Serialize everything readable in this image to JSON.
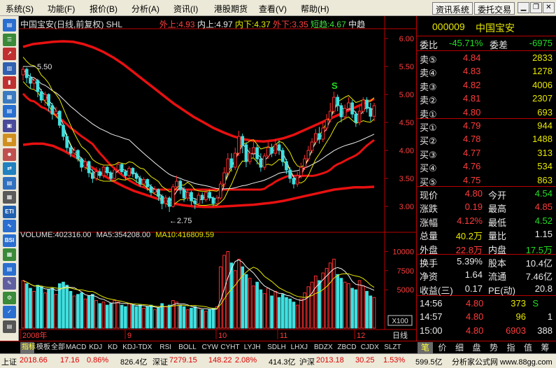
{
  "menu": {
    "items": [
      "系统(S)",
      "功能(F)",
      "报价(B)",
      "分析(A)",
      "资讯(I)",
      "港股期货",
      "查看(V)",
      "帮助(H)"
    ],
    "right_buttons": [
      "资讯系统",
      "委托交易"
    ]
  },
  "toolbar": {
    "icons": [
      "window-icon",
      "list-icon",
      "line-chart-icon",
      "volume-chart-icon",
      "bar-chart-icon",
      "grid-icon",
      "table-icon",
      "page-icon",
      "folder-icon",
      "people-icon",
      "exchange-icon",
      "report-icon",
      "calc-icon",
      "eti-icon",
      "chart-line-icon",
      "bsi-icon",
      "group-icon",
      "doc-icon",
      "wand-icon",
      "gear-icon",
      "tag-icon",
      "scroll-icon"
    ]
  },
  "chart": {
    "legend": {
      "name": "中国宝安(日线,前复权) SHL",
      "wai_shang": "外上:4.93",
      "nei_shang": "内上:4.97",
      "nei_xia": "内下:4.37",
      "wai_xia": "外下:3.35",
      "duan_qu": "短趋:4.67",
      "zhong_qu": "中趋"
    },
    "annotations": {
      "high": "5.50",
      "low": "←2.75",
      "signal": "S"
    },
    "x_labels": [
      "2008年",
      "9",
      "10",
      "11",
      "12"
    ],
    "period_label": "日线",
    "vol_scale": "X100",
    "volume_info": {
      "volume": "VOLUME:402316.00",
      "ma5": "MA5:354208.00",
      "ma10": "MA10:416809.59"
    }
  },
  "chart_data": {
    "type": "candlestick",
    "y_ticks": [
      "6.00",
      "5.50",
      "5.00",
      "4.50",
      "4.00",
      "3.50",
      "3.00"
    ],
    "ylim": [
      2.6,
      6.1
    ],
    "vol_ticks": [
      "10000",
      "7500",
      "5000"
    ],
    "vol_ylim": [
      0,
      11500
    ],
    "candles": [
      [
        5.35,
        5.45,
        5.5,
        5.25,
        6200
      ],
      [
        5.45,
        5.3,
        5.48,
        5.2,
        5800
      ],
      [
        5.3,
        5.2,
        5.38,
        5.1,
        5200
      ],
      [
        5.2,
        5.25,
        5.3,
        5.08,
        4800
      ],
      [
        5.25,
        5.05,
        5.28,
        4.95,
        5600
      ],
      [
        5.05,
        4.9,
        5.1,
        4.85,
        5400
      ],
      [
        4.9,
        5.0,
        5.05,
        4.8,
        4600
      ],
      [
        5.0,
        4.8,
        5.02,
        4.7,
        5000
      ],
      [
        4.8,
        4.65,
        4.85,
        4.55,
        5200
      ],
      [
        4.65,
        4.7,
        4.78,
        4.58,
        4400
      ],
      [
        4.7,
        4.45,
        4.72,
        4.4,
        5800
      ],
      [
        4.45,
        4.25,
        4.48,
        4.18,
        6000
      ],
      [
        4.25,
        4.05,
        4.3,
        3.98,
        5600
      ],
      [
        4.05,
        3.95,
        4.1,
        3.88,
        4800
      ],
      [
        3.95,
        4.0,
        4.06,
        3.9,
        4200
      ],
      [
        4.0,
        3.85,
        4.02,
        3.8,
        4400
      ],
      [
        3.85,
        3.7,
        3.88,
        3.62,
        4600
      ],
      [
        3.7,
        3.8,
        3.86,
        3.65,
        3800
      ],
      [
        3.8,
        3.6,
        3.82,
        3.52,
        4200
      ],
      [
        3.6,
        3.5,
        3.66,
        3.42,
        4400
      ],
      [
        3.5,
        3.62,
        3.7,
        3.46,
        3600
      ],
      [
        3.62,
        3.55,
        3.68,
        3.5,
        3200
      ],
      [
        3.55,
        3.7,
        3.75,
        3.5,
        3400
      ],
      [
        3.7,
        3.6,
        3.72,
        3.55,
        3000
      ],
      [
        3.6,
        3.5,
        3.64,
        3.45,
        3200
      ],
      [
        3.5,
        3.65,
        3.7,
        3.48,
        3600
      ],
      [
        3.65,
        3.75,
        3.8,
        3.6,
        3400
      ],
      [
        3.75,
        3.62,
        3.78,
        3.58,
        3000
      ],
      [
        3.62,
        3.55,
        3.66,
        3.48,
        2800
      ],
      [
        3.55,
        3.68,
        3.72,
        3.52,
        3200
      ],
      [
        3.68,
        3.58,
        3.7,
        3.52,
        3000
      ],
      [
        3.58,
        3.5,
        3.62,
        3.42,
        2800
      ],
      [
        3.5,
        3.4,
        3.55,
        3.35,
        3000
      ],
      [
        3.4,
        3.48,
        3.52,
        3.35,
        2600
      ],
      [
        3.48,
        3.35,
        3.5,
        3.28,
        2800
      ],
      [
        3.35,
        3.25,
        3.4,
        3.18,
        3000
      ],
      [
        3.25,
        3.3,
        3.36,
        3.2,
        2400
      ],
      [
        3.3,
        3.18,
        3.32,
        3.1,
        2600
      ],
      [
        3.18,
        3.05,
        3.22,
        2.95,
        3200
      ],
      [
        3.05,
        3.15,
        3.2,
        2.98,
        2800
      ],
      [
        3.15,
        3.0,
        3.18,
        2.9,
        3000
      ],
      [
        3.0,
        3.35,
        3.4,
        2.98,
        3600
      ],
      [
        3.35,
        3.45,
        3.55,
        3.3,
        3400
      ],
      [
        3.45,
        3.3,
        3.48,
        3.22,
        3000
      ],
      [
        3.3,
        3.15,
        3.35,
        3.08,
        2800
      ],
      [
        3.15,
        3.25,
        3.3,
        3.1,
        2400
      ],
      [
        3.25,
        3.1,
        3.28,
        3.02,
        2600
      ],
      [
        3.1,
        3.05,
        3.15,
        2.95,
        2800
      ],
      [
        3.05,
        3.2,
        3.25,
        3.0,
        2600
      ],
      [
        3.2,
        3.12,
        3.25,
        3.05,
        2400
      ],
      [
        3.12,
        3.25,
        3.3,
        3.08,
        2200
      ],
      [
        3.25,
        3.15,
        3.3,
        3.1,
        2400
      ],
      [
        3.15,
        3.05,
        3.18,
        3.0,
        2600
      ],
      [
        3.05,
        3.15,
        3.2,
        3.02,
        2800
      ],
      [
        3.15,
        3.4,
        3.45,
        3.12,
        8000
      ],
      [
        3.4,
        3.6,
        3.7,
        3.35,
        9500
      ],
      [
        3.6,
        3.85,
        3.95,
        3.55,
        10000
      ],
      [
        3.85,
        3.7,
        3.95,
        3.62,
        8500
      ],
      [
        3.7,
        3.95,
        4.05,
        3.65,
        7500
      ],
      [
        3.95,
        4.25,
        4.35,
        3.9,
        9000
      ],
      [
        4.25,
        4.1,
        4.3,
        3.95,
        8000
      ],
      [
        4.1,
        3.8,
        4.15,
        3.7,
        7000
      ],
      [
        3.8,
        3.95,
        4.05,
        3.75,
        6500
      ],
      [
        3.95,
        4.05,
        4.15,
        3.85,
        5500
      ],
      [
        4.05,
        3.85,
        4.1,
        3.75,
        6000
      ],
      [
        3.85,
        3.7,
        3.95,
        3.62,
        5000
      ],
      [
        3.7,
        3.9,
        3.95,
        3.65,
        4500
      ],
      [
        3.9,
        4.05,
        4.15,
        3.85,
        5200
      ],
      [
        4.05,
        3.95,
        4.12,
        3.88,
        4200
      ],
      [
        3.95,
        4.1,
        4.2,
        3.9,
        4800
      ],
      [
        4.1,
        4.0,
        4.18,
        3.92,
        4000
      ],
      [
        4.0,
        3.8,
        4.05,
        3.72,
        4400
      ],
      [
        3.8,
        3.65,
        3.85,
        3.58,
        4000
      ],
      [
        3.65,
        3.5,
        3.7,
        3.42,
        3800
      ],
      [
        3.5,
        3.4,
        3.55,
        3.32,
        3400
      ],
      [
        3.4,
        3.55,
        3.62,
        3.35,
        3000
      ],
      [
        3.55,
        3.7,
        3.78,
        3.5,
        3800
      ],
      [
        3.7,
        3.85,
        3.92,
        3.65,
        4600
      ],
      [
        3.85,
        4.0,
        4.08,
        3.8,
        5400
      ],
      [
        4.0,
        4.15,
        4.22,
        3.95,
        6000
      ],
      [
        4.15,
        4.3,
        4.38,
        4.1,
        6800
      ],
      [
        4.3,
        4.2,
        4.42,
        4.12,
        6200
      ],
      [
        4.2,
        4.4,
        4.5,
        4.15,
        7200
      ],
      [
        4.4,
        4.55,
        4.65,
        4.35,
        7800
      ],
      [
        4.55,
        4.7,
        4.85,
        4.5,
        8500
      ],
      [
        4.7,
        4.95,
        5.05,
        4.65,
        9000
      ],
      [
        4.95,
        4.8,
        5.0,
        4.7,
        7000
      ],
      [
        4.8,
        4.6,
        4.85,
        4.5,
        6500
      ],
      [
        4.6,
        4.75,
        4.82,
        4.55,
        6000
      ],
      [
        4.75,
        4.85,
        4.95,
        4.7,
        5800
      ],
      [
        4.85,
        4.65,
        4.9,
        4.58,
        5200
      ],
      [
        4.65,
        4.5,
        4.7,
        4.42,
        5000
      ],
      [
        4.5,
        4.7,
        4.78,
        4.45,
        6200
      ],
      [
        4.7,
        4.9,
        4.95,
        4.65,
        5500
      ],
      [
        4.9,
        4.75,
        4.95,
        4.68,
        4800
      ],
      [
        4.75,
        4.61,
        4.85,
        4.52,
        4200
      ],
      [
        4.61,
        4.8,
        4.85,
        4.52,
        4000
      ]
    ],
    "lines": {
      "outer_upper": [
        5.85,
        5.9,
        5.92,
        5.94,
        5.95,
        5.94,
        5.9,
        5.84,
        5.76,
        5.66,
        5.54,
        5.4,
        5.26,
        5.12,
        4.98,
        4.84,
        4.72,
        4.6,
        4.5,
        4.4,
        4.32,
        4.25,
        4.2,
        4.17,
        4.16,
        4.18,
        4.22,
        4.28,
        4.36,
        4.44,
        4.52,
        4.6,
        4.68,
        4.76,
        4.84,
        4.92
      ],
      "inner_lower": [
        4.1,
        4.12,
        4.12,
        4.08,
        4.0,
        3.9,
        3.8,
        3.68,
        3.56,
        3.45,
        3.36,
        3.28,
        3.22,
        3.16,
        3.1,
        3.05,
        3.02,
        3.0,
        2.99,
        2.99,
        3.0,
        3.01,
        3.02,
        3.03,
        3.05,
        3.07,
        3.1,
        3.14,
        3.18,
        3.22,
        3.26,
        3.3,
        3.32,
        3.34,
        3.34,
        3.35
      ]
    }
  },
  "quote": {
    "code": "000009",
    "name": "中国宝安",
    "weibi_label": "委比",
    "weibi": "-45.71%",
    "weicha_label": "委差",
    "weicha": "-6975",
    "sells": [
      {
        "label": "卖⑤",
        "price": "4.84",
        "vol": "2833"
      },
      {
        "label": "卖④",
        "price": "4.83",
        "vol": "1278"
      },
      {
        "label": "卖③",
        "price": "4.82",
        "vol": "4006"
      },
      {
        "label": "卖②",
        "price": "4.81",
        "vol": "2307"
      },
      {
        "label": "卖①",
        "price": "4.80",
        "vol": "693"
      }
    ],
    "buys": [
      {
        "label": "买①",
        "price": "4.79",
        "vol": "944"
      },
      {
        "label": "买②",
        "price": "4.78",
        "vol": "1488"
      },
      {
        "label": "买③",
        "price": "4.77",
        "vol": "313"
      },
      {
        "label": "买④",
        "price": "4.76",
        "vol": "534"
      },
      {
        "label": "买⑤",
        "price": "4.75",
        "vol": "863"
      }
    ],
    "stats": [
      {
        "l1": "现价",
        "v1": "4.80",
        "l2": "今开",
        "v2": "4.54"
      },
      {
        "l1": "涨跌",
        "v1": "0.19",
        "l2": "最高",
        "v2": "4.85"
      },
      {
        "l1": "涨幅",
        "v1": "4.12%",
        "l2": "最低",
        "v2": "4.52"
      },
      {
        "l1": "总量",
        "v1": "40.2万",
        "l2": "量比",
        "v2": "1.15"
      },
      {
        "l1": "外盘",
        "v1": "22.8万",
        "l2": "内盘",
        "v2": "17.5万"
      }
    ],
    "stats2": [
      {
        "l1": "换手",
        "v1": "5.39%",
        "l2": "股本",
        "v2": "10.4亿"
      },
      {
        "l1": "净资",
        "v1": "1.64",
        "l2": "流通",
        "v2": "7.46亿"
      },
      {
        "l1": "收益(三)",
        "v1": "0.17",
        "l2": "PE(动)",
        "v2": "20.8"
      }
    ],
    "ticks": [
      {
        "time": "14:56",
        "price": "4.80",
        "vol": "373",
        "flag": "S"
      },
      {
        "time": "14:57",
        "price": "4.80",
        "vol": "96",
        "flag": ""
      },
      {
        "time": "15:00",
        "price": "4.80",
        "vol": "6903",
        "flag": ""
      }
    ],
    "tick_extra": [
      "1",
      "388"
    ]
  },
  "tabs": {
    "items": [
      "指标",
      "模板",
      "全部",
      "MACD",
      "KDJ",
      "KD",
      "KDJ-TDX",
      "RSI",
      "BOLL",
      "CYW",
      "CYHT",
      "LYJH",
      "SDLH",
      "LHXJ",
      "BDZX",
      "ZBCD",
      "CJDX",
      "SLZT"
    ],
    "right": [
      "笔",
      "价",
      "细",
      "盘",
      "势",
      "指",
      "值",
      "筹"
    ]
  },
  "status": {
    "sh_label": "上证",
    "sh_val": "2018.66",
    "sh_chg": "17.16",
    "sh_pct": "0.86%",
    "sh_amt": "826.4亿",
    "sz_label": "深证",
    "sz_val": "7279.15",
    "sz_chg": "148.22",
    "sz_pct": "2.08%",
    "sz_amt": "414.3亿",
    "hs_label": "沪深",
    "hs_val": "2013.18",
    "hs_chg": "30.25",
    "hs_pct": "1.53%",
    "hs_amt": "599.5亿",
    "watermark": "分析家公式网 www.88gg.com"
  }
}
